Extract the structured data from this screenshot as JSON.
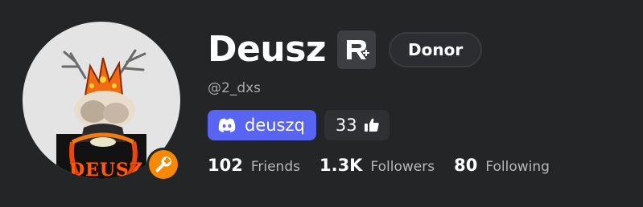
{
  "profile": {
    "display_name": "Deusz",
    "username": "@2_dxs",
    "premium_icon": "roblox-premium-icon",
    "badge": "Donor",
    "avatar_icon": "developer-wrench-icon",
    "avatar_hat_text": "DEUSZ"
  },
  "social": {
    "discord_label": "deuszq",
    "likes_count": "33",
    "accent_color": "#5865f2"
  },
  "stats": [
    {
      "value": "102",
      "label": "Friends"
    },
    {
      "value": "1.3K",
      "label": "Followers"
    },
    {
      "value": "80",
      "label": "Following"
    }
  ],
  "colors": {
    "background": "#232527",
    "developer_badge": "#f68802"
  }
}
